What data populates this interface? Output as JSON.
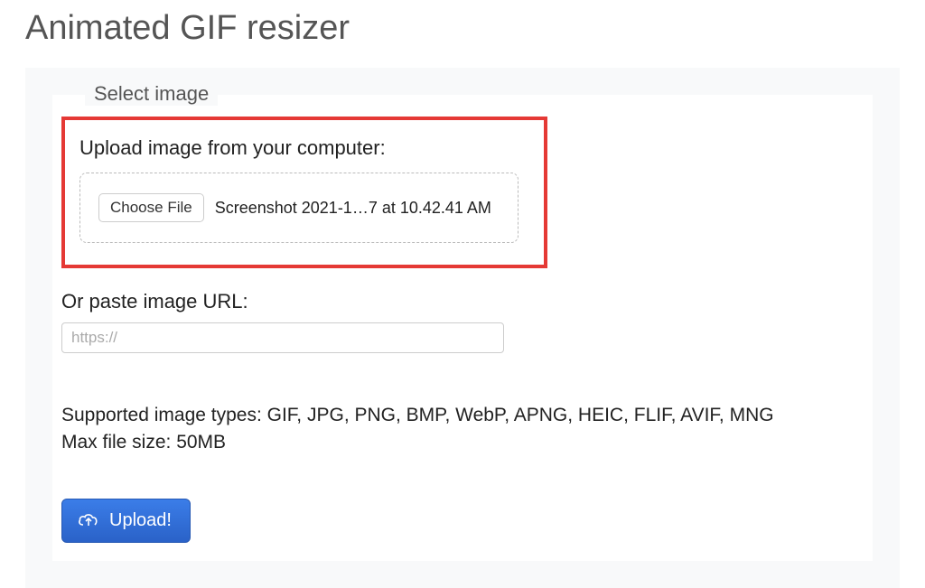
{
  "page_title": "Animated GIF resizer",
  "fieldset": {
    "legend": "Select image",
    "upload_label": "Upload image from your computer:",
    "choose_file_label": "Choose File",
    "selected_file_name": "Screenshot 2021-1…7 at 10.42.41 AM",
    "url_label": "Or paste image URL:",
    "url_placeholder": "https://",
    "supported_types_line": "Supported image types: GIF, JPG, PNG, BMP, WebP, APNG, HEIC, FLIF, AVIF, MNG",
    "max_size_line": "Max file size: 50MB",
    "upload_button_label": "Upload!"
  }
}
